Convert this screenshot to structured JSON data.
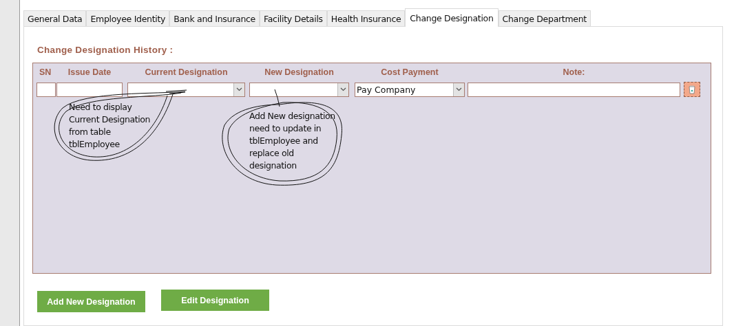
{
  "tabs": [
    {
      "label": "General Data",
      "selected": false
    },
    {
      "label": "Employee Identity",
      "selected": false
    },
    {
      "label": "Bank and Insurance",
      "selected": false
    },
    {
      "label": "Facility Details",
      "selected": false
    },
    {
      "label": "Health Insurance",
      "selected": false
    },
    {
      "label": "Change Designation",
      "selected": true
    },
    {
      "label": "Change Department",
      "selected": false
    }
  ],
  "section_title": "Change Designation History :",
  "table": {
    "columns": [
      {
        "label": "SN",
        "kind": "text"
      },
      {
        "label": "Issue Date",
        "kind": "text"
      },
      {
        "label": "Current Designation",
        "kind": "combo"
      },
      {
        "label": "New Designation",
        "kind": "combo"
      },
      {
        "label": "Cost Payment",
        "kind": "combo",
        "value": "Pay Company"
      },
      {
        "label": "Note:",
        "kind": "text"
      }
    ]
  },
  "annotations": [
    {
      "lines": [
        "Need to display",
        "Current Designation",
        "from table",
        "tblEmployee"
      ]
    },
    {
      "lines": [
        "Add New designation",
        "need to update in",
        "tblEmployee and",
        "replace old",
        "designation"
      ]
    }
  ],
  "buttons": [
    "Add New Designation",
    "Edit Designation"
  ]
}
